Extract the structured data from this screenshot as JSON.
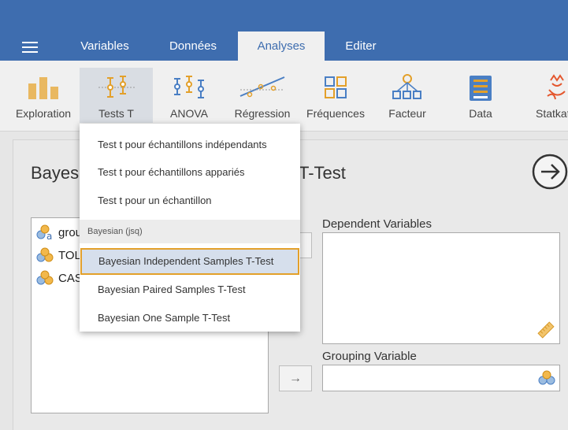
{
  "menu": {
    "tabs": [
      {
        "label": "Variables"
      },
      {
        "label": "Données"
      },
      {
        "label": "Analyses"
      },
      {
        "label": "Editer"
      }
    ],
    "active_tab": "Analyses"
  },
  "ribbon": {
    "buttons": [
      {
        "label": "Exploration",
        "icon": "exploration-icon"
      },
      {
        "label": "Tests T",
        "icon": "ttest-icon"
      },
      {
        "label": "ANOVA",
        "icon": "anova-icon"
      },
      {
        "label": "Régression",
        "icon": "regression-icon"
      },
      {
        "label": "Fréquences",
        "icon": "frequencies-icon"
      },
      {
        "label": "Facteur",
        "icon": "factor-icon"
      },
      {
        "label": "Data",
        "icon": "data-icon"
      },
      {
        "label": "Statkat",
        "icon": "statkat-icon"
      }
    ]
  },
  "dropdown": {
    "items": [
      {
        "label": "Test t pour échantillons indépendants"
      },
      {
        "label": "Test t pour échantillons appariés"
      },
      {
        "label": "Test t pour un échantillon"
      }
    ],
    "section_label": "Bayesian (jsq)",
    "bayes_items": [
      {
        "label": "Bayesian Independent Samples T-Test"
      },
      {
        "label": "Bayesian Paired Samples T-Test"
      },
      {
        "label": "Bayesian One Sample T-Test"
      }
    ]
  },
  "analysis": {
    "title_left": "Bayes",
    "title_right": "T-Test",
    "variables": [
      {
        "label": "grou"
      },
      {
        "label": "TOL"
      },
      {
        "label": "CAS"
      }
    ],
    "dependent_label": "Dependent Variables",
    "grouping_label": "Grouping Variable",
    "move_arrow": "→"
  },
  "colors": {
    "topbar": "#3e6daf",
    "accent_orange": "#e3a02a",
    "icon_blue": "#4a7fc4"
  }
}
